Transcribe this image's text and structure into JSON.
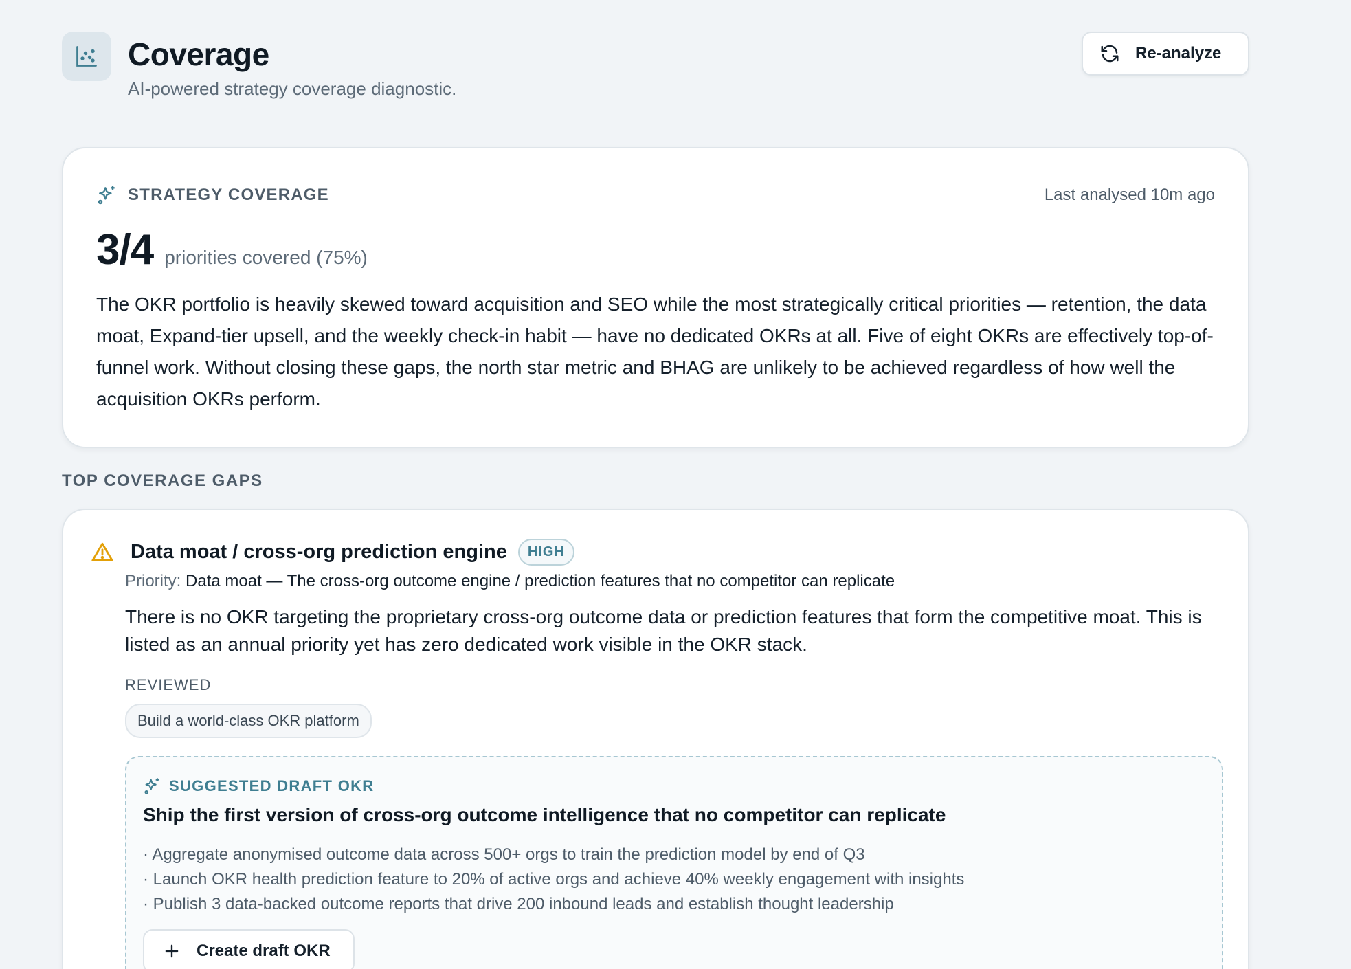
{
  "header": {
    "title": "Coverage",
    "subtitle": "AI-powered strategy coverage diagnostic.",
    "reanalyze_label": "Re-analyze"
  },
  "summary": {
    "label": "STRATEGY COVERAGE",
    "last_analysed": "Last analysed 10m ago",
    "score": "3/4",
    "score_caption": "priorities covered (75%)",
    "text": "The OKR portfolio is heavily skewed toward acquisition and SEO while the most strategically critical priorities — retention, the data moat, Expand-tier upsell, and the weekly check-in habit — have no dedicated OKRs at all. Five of eight OKRs are effectively top-of-funnel work. Without closing these gaps, the north star metric and BHAG are unlikely to be achieved regardless of how well the acquisition OKRs perform."
  },
  "gaps_section_label": "TOP COVERAGE GAPS",
  "gaps": [
    {
      "title": "Data moat / cross-org prediction engine",
      "severity": "HIGH",
      "priority_key": "Priority:",
      "priority_value": "Data moat — The cross-org outcome engine / prediction features that no competitor can replicate",
      "description": "There is no OKR targeting the proprietary cross-org outcome data or prediction features that form the competitive moat. This is listed as an annual priority yet has zero dedicated work visible in the OKR stack.",
      "reviewed_label": "REVIEWED",
      "reviewed_items": [
        "Build a world-class OKR platform"
      ],
      "draft": {
        "label": "SUGGESTED DRAFT OKR",
        "title": "Ship the first version of cross-org outcome intelligence that no competitor can replicate",
        "key_results": [
          "· Aggregate anonymised outcome data across 500+ orgs to train the prediction model by end of Q3",
          "· Launch OKR health prediction feature to 20% of active orgs and achieve 40% weekly engagement with insights",
          "· Publish 3 data-backed outcome reports that drive 200 inbound leads and establish thought leadership"
        ],
        "create_label": "Create draft OKR"
      }
    }
  ],
  "colors": {
    "background": "#f1f4f7",
    "accent": "#3f7e91",
    "warning": "#e3a008",
    "text": "#15202b",
    "muted": "#5d6b78"
  },
  "icons": {
    "header": "scatter-chart-icon",
    "reanalyze": "refresh-icon",
    "summary": "sparkles-icon",
    "gap": "warning-triangle-icon",
    "draft": "sparkles-icon",
    "create": "plus-icon"
  }
}
